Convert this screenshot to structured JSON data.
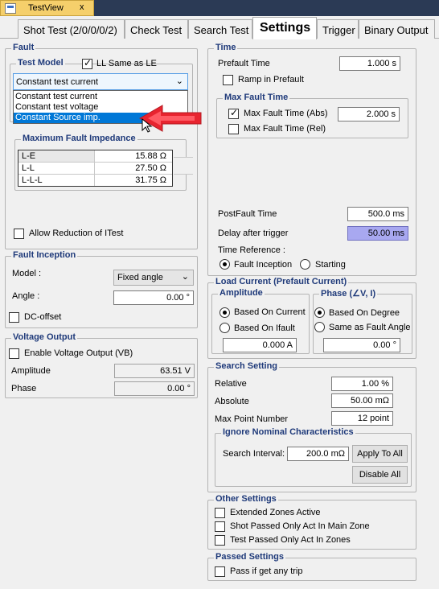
{
  "window": {
    "doc_tab": "TestView",
    "close": "x"
  },
  "tabs": [
    "Shot Test (2/0/0/0/2)",
    "Check Test",
    "Search Test",
    "Settings",
    "Trigger",
    "Binary Output"
  ],
  "fault": {
    "title": "Fault",
    "test_model": {
      "title": "Test Model",
      "ll_same_label": "LL Same as LE",
      "selected": "Constant test current",
      "options": [
        "Constant test current",
        "Constant test voltage",
        "Constant Source imp."
      ]
    },
    "impedance": {
      "title": "Maximum Fault Impedance",
      "rows": [
        {
          "name": "L-E",
          "value": "15.88 Ω"
        },
        {
          "name": "L-L",
          "value": "27.50 Ω"
        },
        {
          "name": "L-L-L",
          "value": "31.75 Ω"
        }
      ]
    },
    "allow_reduction_label": "Allow Reduction of ITest"
  },
  "fault_inception": {
    "title": "Fault Inception",
    "model_label": "Model :",
    "model_value": "Fixed angle",
    "angle_label": "Angle :",
    "angle_value": "0.00 °",
    "dc_offset_label": "DC-offset"
  },
  "voltage_output": {
    "title": "Voltage Output",
    "enable_label": "Enable Voltage Output (VB)",
    "amplitude_label": "Amplitude",
    "amplitude_value": "63.51 V",
    "phase_label": "Phase",
    "phase_value": "0.00 °"
  },
  "time": {
    "title": "Time",
    "prefault_label": "Prefault Time",
    "prefault_value": "1.000 s",
    "ramp_label": "Ramp in Prefault",
    "max_fault": {
      "title": "Max Fault Time",
      "abs_label": "Max Fault Time (Abs)",
      "abs_value": "2.000 s",
      "rel_label": "Max Fault Time (Rel)"
    },
    "postfault_label": "PostFault Time",
    "postfault_value": "500.0 ms",
    "delay_label": "Delay after trigger",
    "delay_value": "50.00 ms",
    "reference_label": "Time Reference :",
    "ref_fault": "Fault Inception",
    "ref_starting": "Starting"
  },
  "load_current": {
    "title": "Load Current (Prefault Current)",
    "amplitude": {
      "title": "Amplitude",
      "based_current": "Based On Current",
      "based_ifault": "Based On Ifault",
      "value": "0.000 A"
    },
    "phase": {
      "title": "Phase (∠V, I)",
      "based_degree": "Based On Degree",
      "same_as_fault": "Same as Fault Angle",
      "value": "0.00 °"
    }
  },
  "search": {
    "title": "Search Setting",
    "relative_label": "Relative",
    "relative_value": "1.00 %",
    "absolute_label": "Absolute",
    "absolute_value": "50.00 mΩ",
    "max_point_label": "Max Point Number",
    "max_point_value": "12 point",
    "ignore": {
      "title": "Ignore Nominal Characteristics",
      "interval_label": "Search Interval:",
      "interval_value": "200.0 mΩ",
      "apply_all": "Apply To All",
      "disable_all": "Disable All"
    }
  },
  "other": {
    "title": "Other Settings",
    "extended": "Extended Zones Active",
    "shot_passed": "Shot Passed Only Act In Main Zone",
    "test_passed": "Test Passed Only Act In Zones"
  },
  "passed": {
    "title": "Passed Settings",
    "pass_any": "Pass if get any trip"
  },
  "colors": {
    "accent": "#1f3a7a",
    "selection": "#0078d7",
    "annotation_arrow": "#e8242f",
    "highlight": "#a8a8f0"
  }
}
